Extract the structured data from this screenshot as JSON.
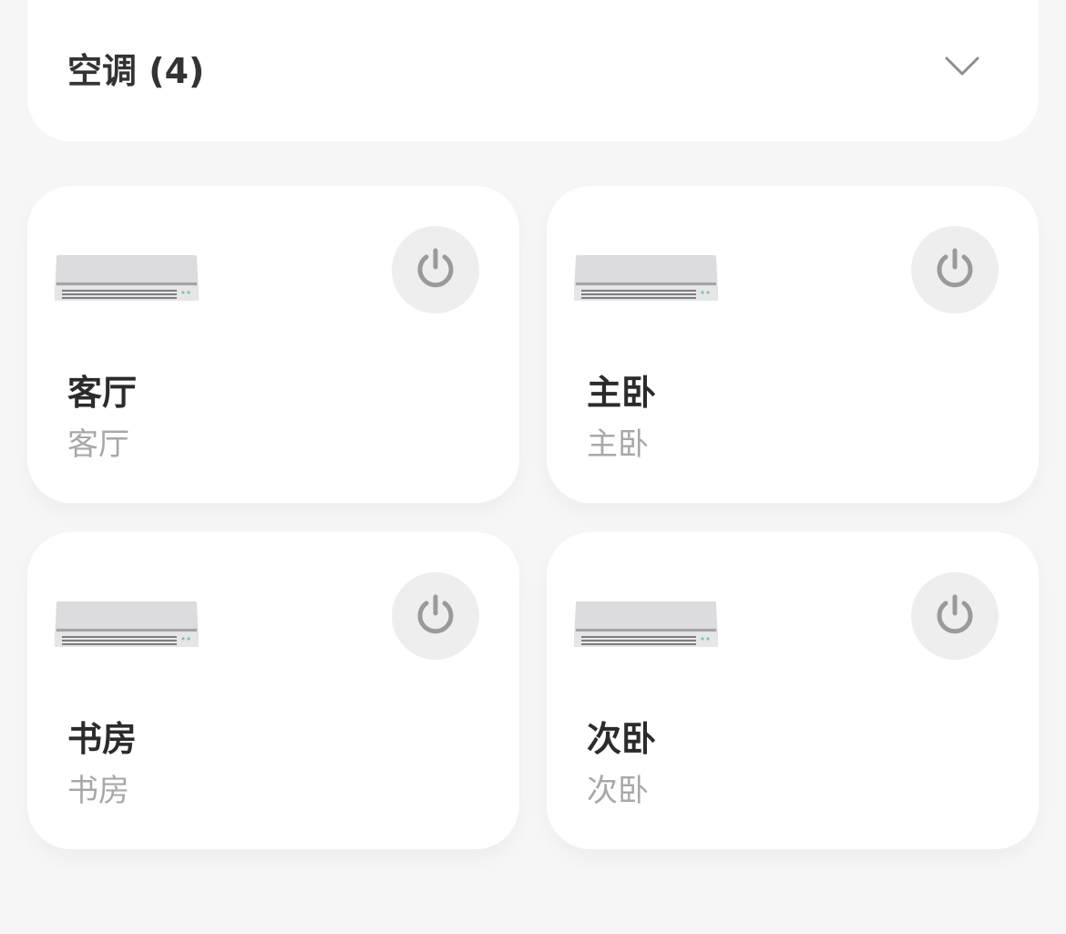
{
  "group": {
    "title": "空调 (4)"
  },
  "devices": [
    {
      "name": "客厅",
      "room": "客厅"
    },
    {
      "name": "主卧",
      "room": "主卧"
    },
    {
      "name": "书房",
      "room": "书房"
    },
    {
      "name": "次卧",
      "room": "次卧"
    }
  ]
}
